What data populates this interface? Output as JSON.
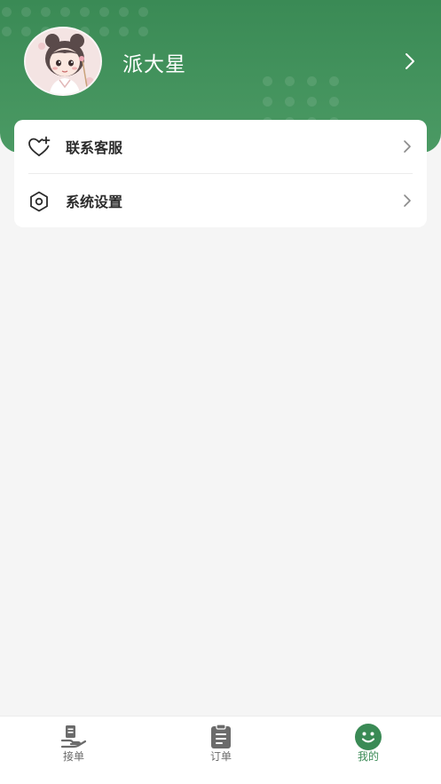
{
  "user": {
    "name": "派大星"
  },
  "menu": [
    {
      "label": "联系客服",
      "icon": "heart-plus-icon"
    },
    {
      "label": "系统设置",
      "icon": "settings-icon"
    }
  ],
  "nav": [
    {
      "label": "接单",
      "icon": "hand-receive-icon",
      "active": false
    },
    {
      "label": "订单",
      "icon": "clipboard-icon",
      "active": false
    },
    {
      "label": "我的",
      "icon": "smiley-icon",
      "active": true
    }
  ],
  "colors": {
    "brand": "#3a8a55",
    "inactive": "#6b6b6b",
    "background": "#f5f5f5"
  }
}
